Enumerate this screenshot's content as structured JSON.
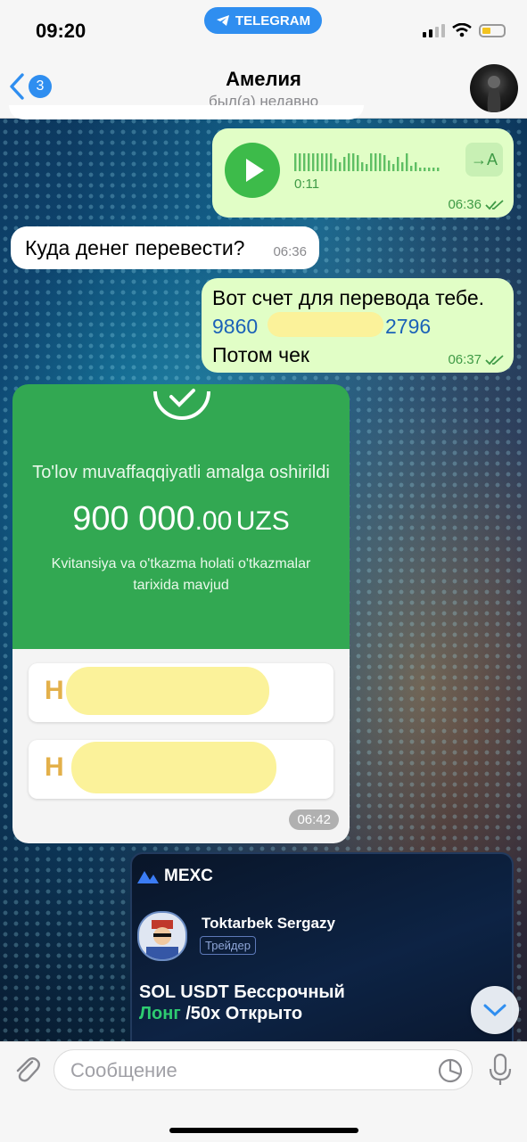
{
  "statusbar": {
    "time": "09:20",
    "app_pill": "TELEGRAM"
  },
  "header": {
    "back_count": "3",
    "name": "Амелия",
    "status": "был(а) недавно"
  },
  "messages": {
    "voice": {
      "duration": "0:11",
      "transcribe": "→A",
      "time": "06:36"
    },
    "in1": {
      "text": "Куда денег перевести?",
      "time": "06:36"
    },
    "out1": {
      "line1": "Вот счет для перевода тебе.",
      "card_start": "9860",
      "card_end": "2796",
      "line3": "Потом чек",
      "time": "06:37"
    },
    "receipt": {
      "title": "To'lov muvaffaqqiyatli amalga oshirildi",
      "amount_main": "900 000",
      "amount_dec": ".00",
      "currency": "UZS",
      "note1": "Kvitansiya va o'tkazma holati o'tkazmalar",
      "note2": "tarixida mavjud",
      "row1_letter": "H",
      "row2_letter": "H",
      "time": "06:42"
    },
    "mexc": {
      "brand": "MEXC",
      "user": "Toktarbek Sergazy",
      "role": "Трейдер",
      "line1": "SOL USDT Бессрочный",
      "line2_green": "Лонг",
      "line2_rest": " /50x Открыто"
    }
  },
  "composer": {
    "placeholder": "Сообщение"
  },
  "colors": {
    "accent": "#2f8ef0",
    "outgoing": "#e1fec6",
    "receipt_green": "#32a852"
  }
}
